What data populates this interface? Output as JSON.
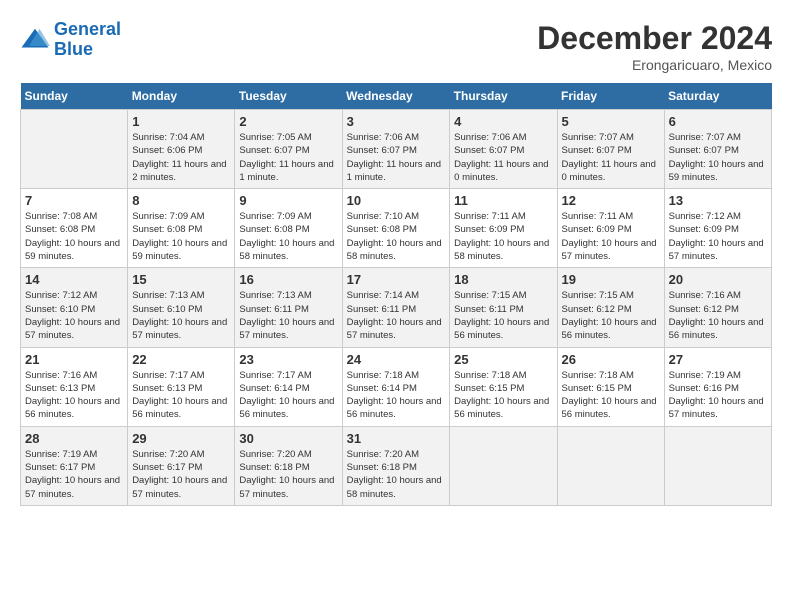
{
  "header": {
    "logo_line1": "General",
    "logo_line2": "Blue",
    "title": "December 2024",
    "subtitle": "Erongaricuaro, Mexico"
  },
  "calendar": {
    "headers": [
      "Sunday",
      "Monday",
      "Tuesday",
      "Wednesday",
      "Thursday",
      "Friday",
      "Saturday"
    ],
    "weeks": [
      [
        {
          "day": "",
          "info": ""
        },
        {
          "day": "",
          "info": ""
        },
        {
          "day": "",
          "info": ""
        },
        {
          "day": "",
          "info": ""
        },
        {
          "day": "",
          "info": ""
        },
        {
          "day": "",
          "info": ""
        },
        {
          "day": "1",
          "info": "Sunrise: 7:04 AM\nSunset: 6:06 PM\nDaylight: 11 hours and 2 minutes."
        }
      ],
      [
        {
          "day": "2",
          "info": "Sunrise: 7:05 AM\nSunset: 6:07 PM\nDaylight: 11 hours and 1 minute."
        },
        {
          "day": "3",
          "info": "Sunrise: 7:06 AM\nSunset: 6:07 PM\nDaylight: 11 hours and 1 minute."
        },
        {
          "day": "4",
          "info": "Sunrise: 7:06 AM\nSunset: 6:07 PM\nDaylight: 11 hours and 0 minutes."
        },
        {
          "day": "5",
          "info": "Sunrise: 7:07 AM\nSunset: 6:07 PM\nDaylight: 11 hours and 0 minutes."
        },
        {
          "day": "6",
          "info": "Sunrise: 7:07 AM\nSunset: 6:07 PM\nDaylight: 10 hours and 59 minutes."
        },
        {
          "day": "7",
          "info": "Sunrise: 7:08 AM\nSunset: 6:08 PM\nDaylight: 10 hours and 59 minutes."
        },
        {
          "day": "",
          "info": ""
        }
      ],
      [
        {
          "day": "8",
          "info": "Sunrise: 7:09 AM\nSunset: 6:08 PM\nDaylight: 10 hours and 59 minutes."
        },
        {
          "day": "9",
          "info": "Sunrise: 7:09 AM\nSunset: 6:08 PM\nDaylight: 10 hours and 58 minutes."
        },
        {
          "day": "10",
          "info": "Sunrise: 7:10 AM\nSunset: 6:08 PM\nDaylight: 10 hours and 58 minutes."
        },
        {
          "day": "11",
          "info": "Sunrise: 7:11 AM\nSunset: 6:09 PM\nDaylight: 10 hours and 58 minutes."
        },
        {
          "day": "12",
          "info": "Sunrise: 7:11 AM\nSunset: 6:09 PM\nDaylight: 10 hours and 57 minutes."
        },
        {
          "day": "13",
          "info": "Sunrise: 7:12 AM\nSunset: 6:09 PM\nDaylight: 10 hours and 57 minutes."
        },
        {
          "day": "14",
          "info": "Sunrise: 7:12 AM\nSunset: 6:10 PM\nDaylight: 10 hours and 57 minutes."
        }
      ],
      [
        {
          "day": "15",
          "info": "Sunrise: 7:13 AM\nSunset: 6:10 PM\nDaylight: 10 hours and 57 minutes."
        },
        {
          "day": "16",
          "info": "Sunrise: 7:13 AM\nSunset: 6:11 PM\nDaylight: 10 hours and 57 minutes."
        },
        {
          "day": "17",
          "info": "Sunrise: 7:14 AM\nSunset: 6:11 PM\nDaylight: 10 hours and 57 minutes."
        },
        {
          "day": "18",
          "info": "Sunrise: 7:15 AM\nSunset: 6:11 PM\nDaylight: 10 hours and 56 minutes."
        },
        {
          "day": "19",
          "info": "Sunrise: 7:15 AM\nSunset: 6:12 PM\nDaylight: 10 hours and 56 minutes."
        },
        {
          "day": "20",
          "info": "Sunrise: 7:16 AM\nSunset: 6:12 PM\nDaylight: 10 hours and 56 minutes."
        },
        {
          "day": "21",
          "info": "Sunrise: 7:16 AM\nSunset: 6:13 PM\nDaylight: 10 hours and 56 minutes."
        }
      ],
      [
        {
          "day": "22",
          "info": "Sunrise: 7:17 AM\nSunset: 6:13 PM\nDaylight: 10 hours and 56 minutes."
        },
        {
          "day": "23",
          "info": "Sunrise: 7:17 AM\nSunset: 6:14 PM\nDaylight: 10 hours and 56 minutes."
        },
        {
          "day": "24",
          "info": "Sunrise: 7:18 AM\nSunset: 6:14 PM\nDaylight: 10 hours and 56 minutes."
        },
        {
          "day": "25",
          "info": "Sunrise: 7:18 AM\nSunset: 6:15 PM\nDaylight: 10 hours and 56 minutes."
        },
        {
          "day": "26",
          "info": "Sunrise: 7:18 AM\nSunset: 6:15 PM\nDaylight: 10 hours and 56 minutes."
        },
        {
          "day": "27",
          "info": "Sunrise: 7:19 AM\nSunset: 6:16 PM\nDaylight: 10 hours and 57 minutes."
        },
        {
          "day": "28",
          "info": "Sunrise: 7:19 AM\nSunset: 6:17 PM\nDaylight: 10 hours and 57 minutes."
        }
      ],
      [
        {
          "day": "29",
          "info": "Sunrise: 7:20 AM\nSunset: 6:17 PM\nDaylight: 10 hours and 57 minutes."
        },
        {
          "day": "30",
          "info": "Sunrise: 7:20 AM\nSunset: 6:18 PM\nDaylight: 10 hours and 57 minutes."
        },
        {
          "day": "31",
          "info": "Sunrise: 7:20 AM\nSunset: 6:18 PM\nDaylight: 10 hours and 58 minutes."
        },
        {
          "day": "",
          "info": ""
        },
        {
          "day": "",
          "info": ""
        },
        {
          "day": "",
          "info": ""
        },
        {
          "day": "",
          "info": ""
        }
      ]
    ]
  }
}
